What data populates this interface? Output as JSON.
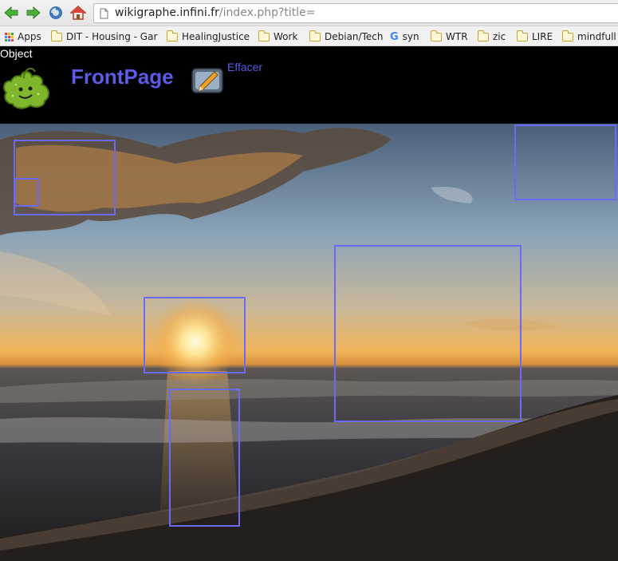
{
  "browser": {
    "url_host": "wikigraphe.infini.fr",
    "url_path": "/index.php?title=",
    "nav": [
      "back-icon",
      "forward-icon",
      "reload-icon",
      "home-icon"
    ]
  },
  "bookmarks": [
    {
      "label": "Apps",
      "icon": "apps-icon"
    },
    {
      "label": "DIT - Housing - Gar",
      "icon": "folder-icon"
    },
    {
      "label": "HealingJustice",
      "icon": "folder-icon"
    },
    {
      "label": "Work",
      "icon": "folder-icon"
    },
    {
      "label": "Debian/Tech",
      "icon": "folder-icon"
    },
    {
      "label": "syn",
      "icon": "google-icon"
    },
    {
      "label": "WTR",
      "icon": "folder-icon"
    },
    {
      "label": "zic",
      "icon": "folder-icon"
    },
    {
      "label": "LIRE",
      "icon": "folder-icon"
    },
    {
      "label": "mindfull",
      "icon": "folder-icon"
    }
  ],
  "page": {
    "object_label": "Object",
    "title": "FrontPage",
    "erase_link": "Effacer"
  },
  "colors": {
    "link": "#5b5be8",
    "region_outline": "#6a6af5",
    "page_bg": "#000000"
  }
}
